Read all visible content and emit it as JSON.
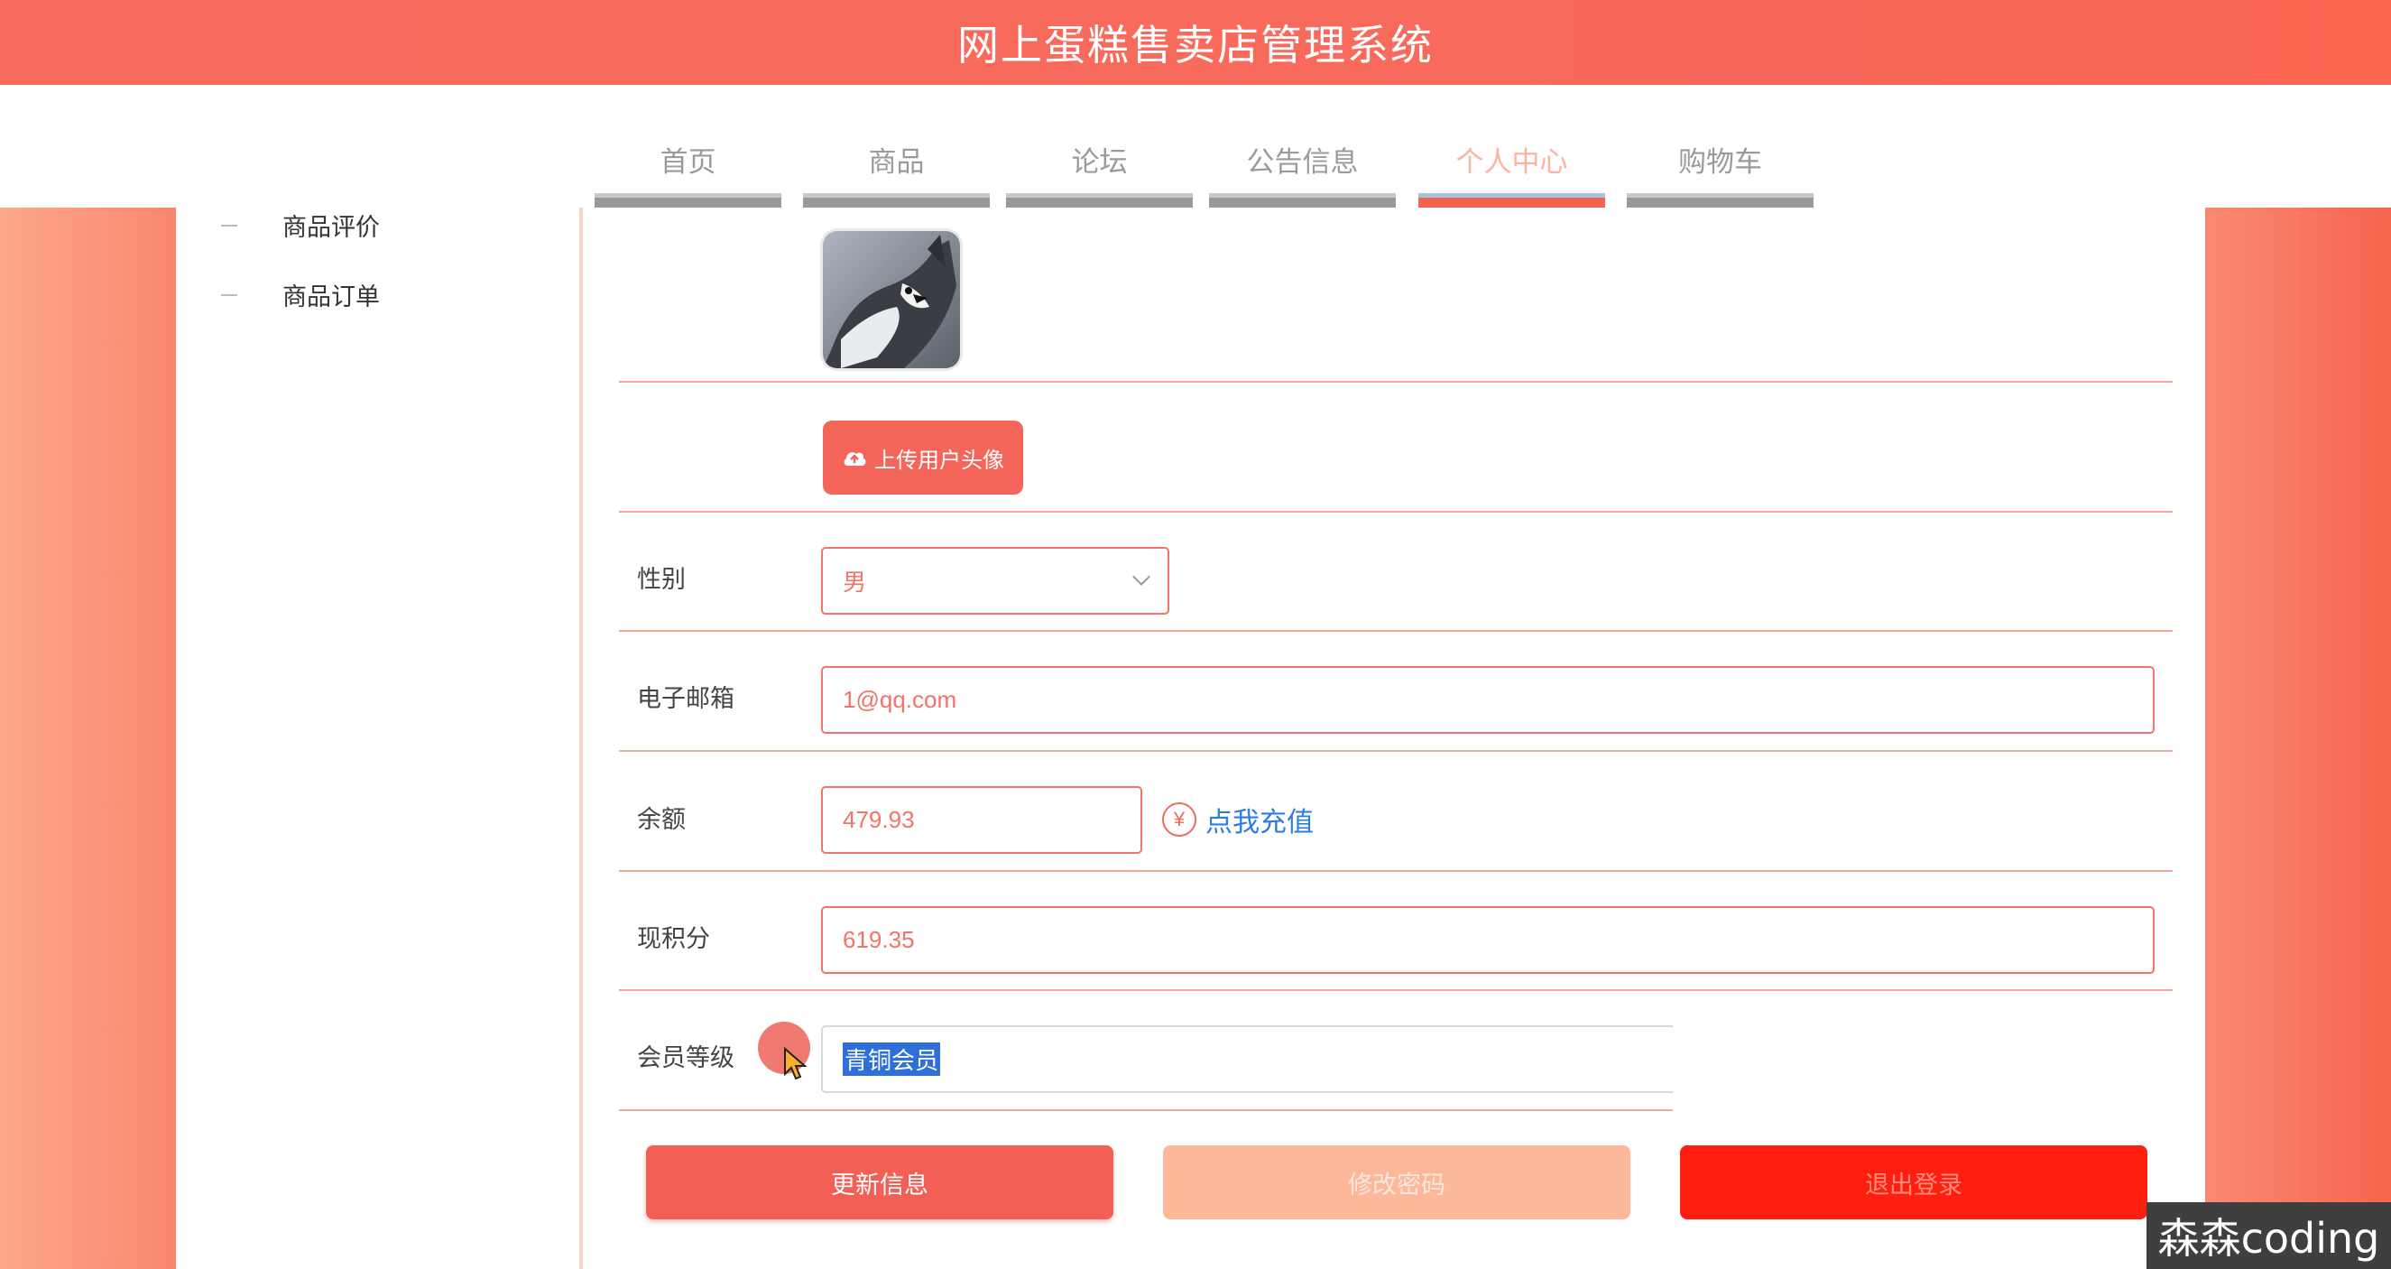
{
  "app": {
    "title": "网上蛋糕售卖店管理系统"
  },
  "nav": {
    "items": [
      {
        "label": "首页"
      },
      {
        "label": "商品"
      },
      {
        "label": "论坛"
      },
      {
        "label": "公告信息"
      },
      {
        "label": "个人中心",
        "active": true
      },
      {
        "label": "购物车"
      }
    ]
  },
  "sidebar": {
    "items": [
      {
        "label": "商品评价"
      },
      {
        "label": "商品订单"
      }
    ]
  },
  "form": {
    "avatar_icon": "husky-avatar-image",
    "upload_button": "上传用户头像",
    "gender": {
      "label": "性别",
      "value": "男"
    },
    "email": {
      "label": "电子邮箱",
      "value": "1@qq.com"
    },
    "balance": {
      "label": "余额",
      "value": "479.93",
      "recharge_label": "点我充值",
      "recharge_icon": "yen-icon"
    },
    "points": {
      "label": "现积分",
      "value": "619.35"
    },
    "member_level": {
      "label": "会员等级",
      "value": "青铜会员"
    }
  },
  "actions": {
    "update_label": "更新信息",
    "change_password_label": "修改密码",
    "logout_label": "退出登录"
  },
  "watermark": "森森coding",
  "colors": {
    "primary": "#f4665a",
    "accent_link": "#2c7de0",
    "selection": "#2f6fd8"
  }
}
